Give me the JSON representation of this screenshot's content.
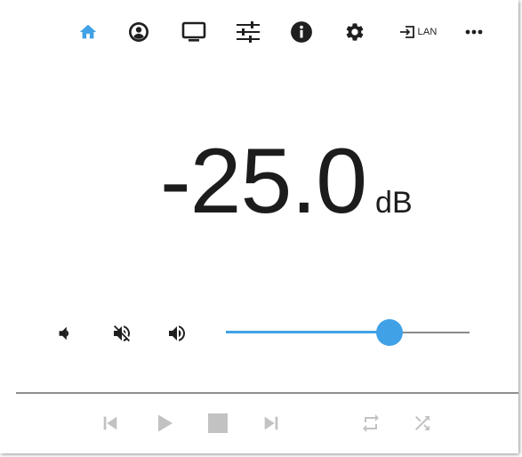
{
  "colors": {
    "accent": "#41a1e6",
    "icon": "#1f1f1f",
    "disabled": "#c2c2c2",
    "text": "#1c1c1c"
  },
  "nav": {
    "items": [
      {
        "name": "home",
        "icon": "home-icon",
        "active": true
      },
      {
        "name": "account",
        "icon": "account-circle-icon",
        "active": false
      },
      {
        "name": "display",
        "icon": "monitor-icon",
        "active": false
      },
      {
        "name": "equalizer",
        "icon": "tune-icon",
        "active": false
      },
      {
        "name": "info",
        "icon": "info-icon",
        "active": false
      },
      {
        "name": "settings",
        "icon": "gear-icon",
        "active": false
      },
      {
        "name": "input",
        "icon": "input-icon",
        "label": "LAN",
        "active": false
      },
      {
        "name": "more",
        "icon": "more-horizontal-icon",
        "active": false
      }
    ]
  },
  "volume": {
    "value": "-25.0",
    "unit": "dB",
    "slider_level": 0.67
  },
  "controls": {
    "volume_down": "volume-down-icon",
    "mute": "volume-mute-icon",
    "volume_up": "volume-up-icon"
  },
  "transport": {
    "items": [
      {
        "name": "previous",
        "icon": "skip-previous-icon",
        "enabled": false
      },
      {
        "name": "play",
        "icon": "play-icon",
        "enabled": false
      },
      {
        "name": "stop",
        "icon": "stop-icon",
        "enabled": false
      },
      {
        "name": "next",
        "icon": "skip-next-icon",
        "enabled": false
      },
      {
        "name": "repeat",
        "icon": "repeat-icon",
        "enabled": false
      },
      {
        "name": "shuffle",
        "icon": "shuffle-icon",
        "enabled": false
      }
    ]
  }
}
